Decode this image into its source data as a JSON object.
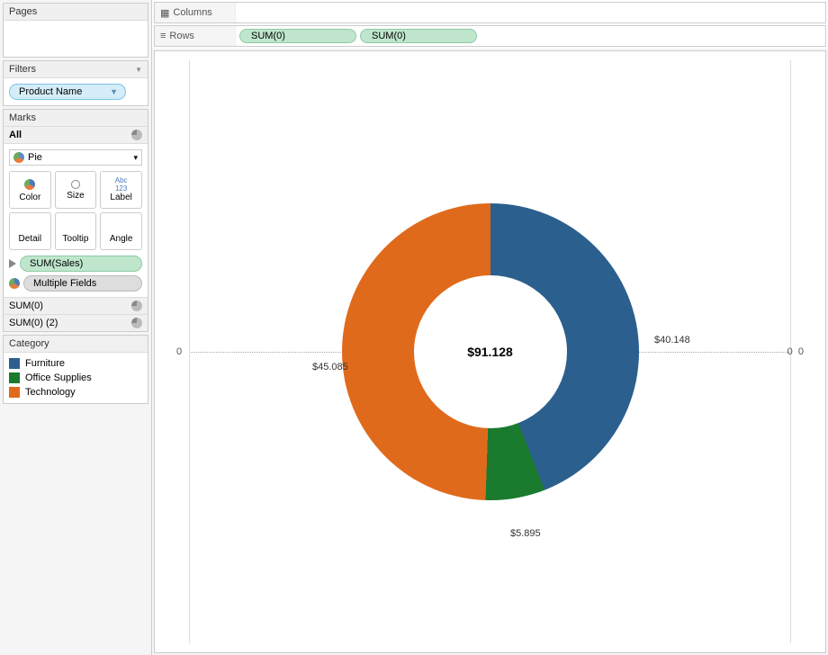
{
  "sidebar": {
    "pages_label": "Pages",
    "filters_label": "Filters",
    "filter_field": "Product Name",
    "marks_label": "Marks",
    "marks_all": "All",
    "mark_type": "Pie",
    "shelves": {
      "color": "Color",
      "size": "Size",
      "label": "Label",
      "detail": "Detail",
      "tooltip": "Tooltip",
      "angle": "Angle"
    },
    "mark_pill1": "SUM(Sales)",
    "mark_pill2": "Multiple Fields",
    "sum_row1": "SUM(0)",
    "sum_row2": "SUM(0) (2)",
    "category_label": "Category",
    "legend": [
      {
        "label": "Furniture",
        "color": "#2b5f8e"
      },
      {
        "label": "Office Supplies",
        "color": "#1a7a2e"
      },
      {
        "label": "Technology",
        "color": "#e06a1b"
      }
    ]
  },
  "shelves": {
    "columns_label": "Columns",
    "rows_label": "Rows",
    "row_field1": "SUM(0)",
    "row_field2": "SUM(0)"
  },
  "chart": {
    "axis_zero_left": "0",
    "axis_zero_right": "0",
    "axis_zero_right2": "0",
    "center_total": "$91.128",
    "label_furniture": "$40.148",
    "label_office": "$5.895",
    "label_tech": "$45.085"
  },
  "chart_data": {
    "type": "pie",
    "title": "",
    "series": [
      {
        "name": "Furniture",
        "value": 40.148,
        "color": "#2b5f8e"
      },
      {
        "name": "Office Supplies",
        "value": 5.895,
        "color": "#1a7a2e"
      },
      {
        "name": "Technology",
        "value": 45.085,
        "color": "#e06a1b"
      }
    ],
    "total": 91.128,
    "inner_radius_ratio": 0.52,
    "currency_prefix": "$"
  }
}
